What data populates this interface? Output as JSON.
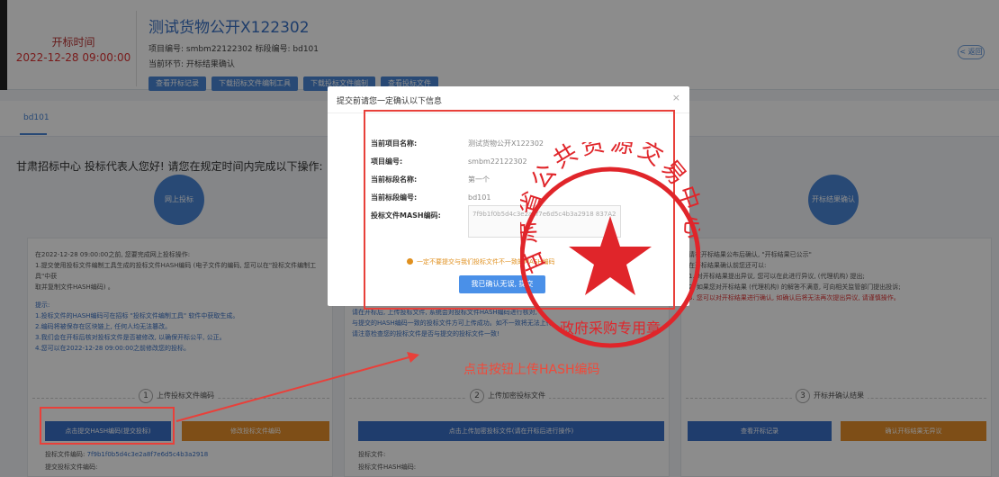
{
  "header": {
    "time_label": "开标时间",
    "time_value": "2022-12-28 09:00:00",
    "project_title": "测试货物公开X122302",
    "meta_line": "项目编号: smbm22122302  标段编号: bd101",
    "meta_line2": "当前环节: 开标结果确认",
    "buttons": [
      "查看开标记录",
      "下载招标文件编制工具",
      "下载投标文件编制",
      "查看投标文件"
    ],
    "right_button": "< 返回"
  },
  "tab": "bd101",
  "greeting": "甘肃招标中心 投标代表人您好! 请您在规定时间内完成以下操作:",
  "circles": {
    "left": "网上投标",
    "right": "开标结果确认"
  },
  "dialog": {
    "title": "提交前请您一定确认以下信息",
    "close": "×",
    "rows": [
      {
        "key": "当前项目名称:",
        "value": "测试货物公开X122302"
      },
      {
        "key": "项目编号:",
        "value": "smbm22122302"
      },
      {
        "key": "当前标段名称:",
        "value": "第一个"
      },
      {
        "key": "当前标段编号:",
        "value": "bd101"
      },
      {
        "key": "投标文件MASH编码:",
        "value": ""
      }
    ],
    "textarea_text": "7f9b1f0b5d4c3e2a8f7e6d5c4b3a2918 837A2",
    "warning": "一定不要提交与我们投标文件不一致的MASH编码",
    "confirm_button": "我已确认无误, 提交"
  },
  "left_col": {
    "line1": "在2022-12-28 09:00:00之前, 您要完成网上投标操作:",
    "line2": "1.提交使用投标文件编制工具生成的投标文件HASH编码 (电子文件的编码, 您可以在\"投标文件编制工具\"中获",
    "line3": "取并复制文件HASH编码) 。",
    "tip_title": "提示:",
    "tips": [
      "1.投标文件的HASH编码可在招标 \"投标文件编制工具\" 软件中获取生成。",
      "2.编码将被保存在区块链上, 任何人均无法篡改。",
      "3.我们会在开标后核对投标文件是否被修改, 以确保开标公平, 公正。",
      "4.您可以在2022-12-28 09:00:00之前修改您的投标。"
    ]
  },
  "mid_col": {
    "line1": "请在开标后, 上传投标文件, 系统会对投标文件HASH编码进行核对,",
    "line2": "与提交的HASH编码一致的投标文件方可上传成功。如不一致将无法上传,",
    "line3": "请注意检查您的投标文件是否与提交的投标文件一致!"
  },
  "right_col": {
    "line1": "请在开标结果公布后确认, \"开标结果已公示\"",
    "line2": "在开标结果确认前您还可以:",
    "line3": "1. 对开标结果提出异议, 您可以在此进行异议, (代理机构) 提出;",
    "line4": "2. 如果您对开标结果 (代理机构) 的解答不满意, 可向相关监管部门提出投诉;",
    "line5": "3. 您可以对开标结果进行确认, 如确认后将无法再次提出异议, 请谨慎操作。"
  },
  "steps": [
    {
      "num": "1",
      "label": "上传投标文件编码"
    },
    {
      "num": "2",
      "label": "上传加密投标文件"
    },
    {
      "num": "3",
      "label": "开标并确认结果"
    }
  ],
  "buttons": {
    "submit_hash": "点击提交HASH编码(提交投标)",
    "modify_hash": "修改投标文件编码",
    "upload_file": "点击上传加密投标文件(请在开标后进行操作)",
    "view_result": "查看开标记录",
    "confirm_result": "确认开标结果无异议"
  },
  "bottom": {
    "left_label": "投标文件编码:",
    "left_value": "7f9b1f0b5d4c3e2a8f7e6d5c4b3a2918",
    "left_label2": "提交投标文件编码:",
    "mid_label": "投标文件:",
    "mid_label2": "投标文件HASH编码:"
  },
  "annotation": "点击按钮上传HASH编码",
  "seal": {
    "ring_text": "甘肃省公共资源交易中心",
    "bottom_text": "政府采购专用章"
  },
  "colors": {
    "primary": "#3a6fc6",
    "orange": "#e58f2a",
    "annotation_red": "#e8403a",
    "seal_red": "#e0252a"
  }
}
